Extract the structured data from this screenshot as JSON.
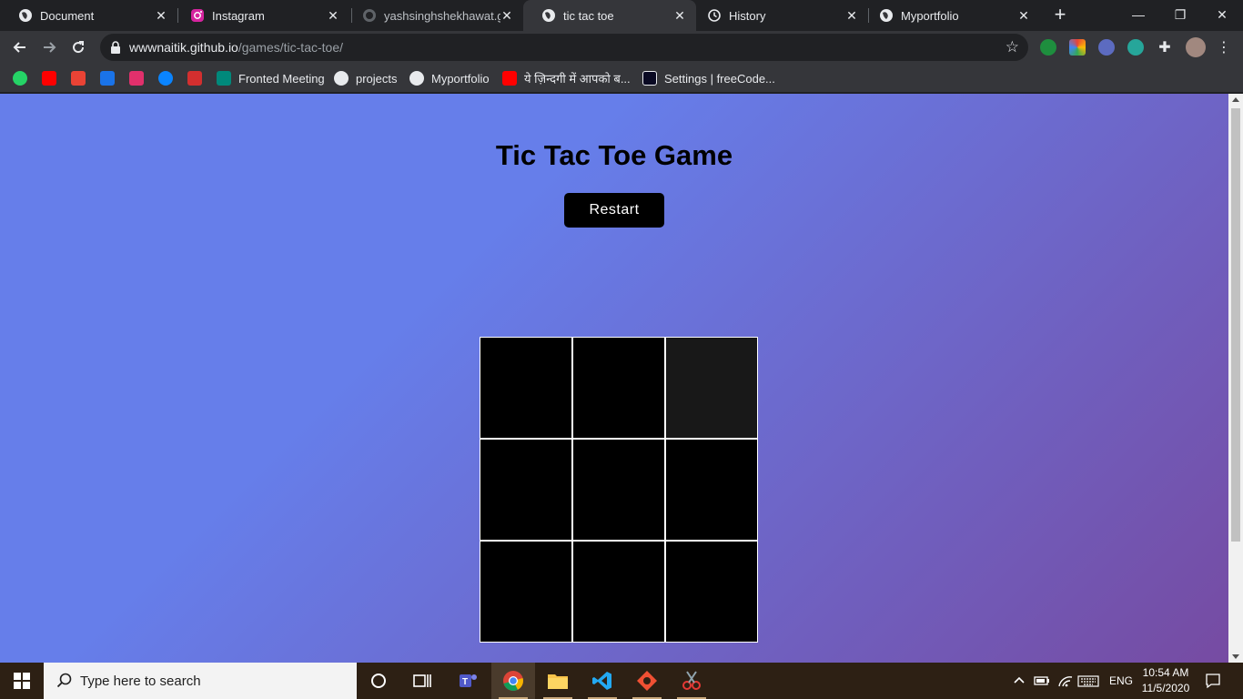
{
  "browser": {
    "tabs": [
      {
        "title": "Document",
        "icon": "globe-icon",
        "active": false
      },
      {
        "title": "Instagram",
        "icon": "instagram-icon",
        "active": false
      },
      {
        "title": "yashsinghshekhawat.gi",
        "icon": "github-icon",
        "active": false
      },
      {
        "title": "tic tac toe",
        "icon": "globe-icon",
        "active": true
      },
      {
        "title": "History",
        "icon": "history-icon",
        "active": false
      },
      {
        "title": "Myportfolio",
        "icon": "globe-icon",
        "active": false
      }
    ],
    "url_host": "wwwnaitik.github.io",
    "url_path": "/games/tic-tac-toe/",
    "bookmarks": [
      {
        "label": "",
        "icon": "whatsapp-icon",
        "color": "#25d366"
      },
      {
        "label": "",
        "icon": "youtube-icon",
        "color": "#ff0000"
      },
      {
        "label": "",
        "icon": "gmail-icon",
        "color": "#ea4335"
      },
      {
        "label": "",
        "icon": "contacts-icon",
        "color": "#1a73e8"
      },
      {
        "label": "",
        "icon": "instagram-icon",
        "color": "#e1306c"
      },
      {
        "label": "",
        "icon": "onedrive-icon",
        "color": "#0a84ff"
      },
      {
        "label": "",
        "icon": "nse-icon",
        "color": "#d32f2f"
      },
      {
        "label": "Fronted Meeting",
        "icon": "meet-icon",
        "color": "#00897b"
      },
      {
        "label": "projects",
        "icon": "globe-icon",
        "color": "#e8eaed"
      },
      {
        "label": "Myportfolio",
        "icon": "globe-icon",
        "color": "#e8eaed"
      },
      {
        "label": "ये ज़िन्दगी में आपको ब...",
        "icon": "youtube-icon",
        "color": "#ff0000"
      },
      {
        "label": "Settings | freeCode...",
        "icon": "freecodecamp-icon",
        "color": "#0a0a23"
      }
    ]
  },
  "page": {
    "title": "Tic Tac Toe Game",
    "restart_label": "Restart",
    "board": [
      "",
      "",
      "",
      "",
      "",
      "",
      "",
      "",
      ""
    ]
  },
  "taskbar": {
    "search_placeholder": "Type here to search",
    "language": "ENG",
    "time": "10:54 AM",
    "date": "11/5/2020"
  }
}
